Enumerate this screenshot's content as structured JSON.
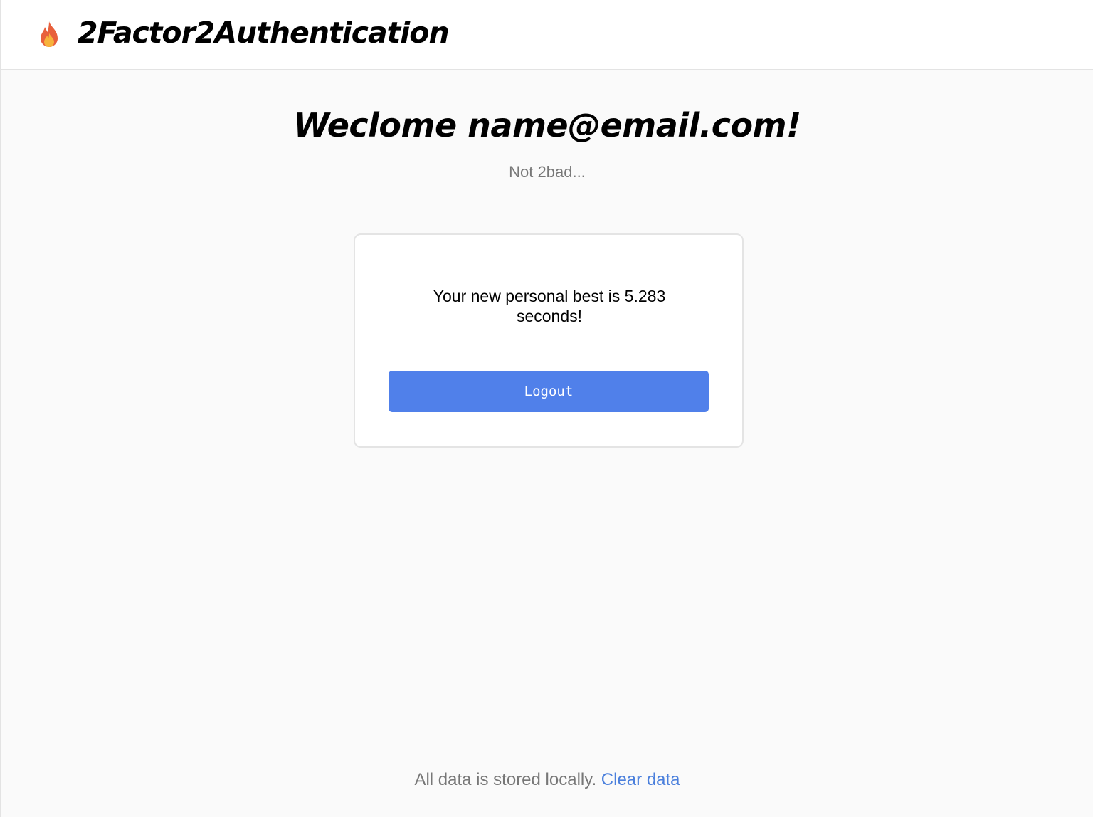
{
  "header": {
    "logo_icon": "fire-icon",
    "title": "2Factor2Authentication"
  },
  "main": {
    "welcome": "Weclome name@email.com!",
    "subtitle": "Not 2bad..."
  },
  "card": {
    "message": "Your new personal best is 5.283 seconds!",
    "logout_label": "Logout"
  },
  "footer": {
    "text": "All data is stored locally.",
    "clear_label": "Clear data"
  },
  "colors": {
    "accent": "#5080ea",
    "link": "#4a7fdc",
    "muted_text": "#777777",
    "background": "#fafafa"
  }
}
